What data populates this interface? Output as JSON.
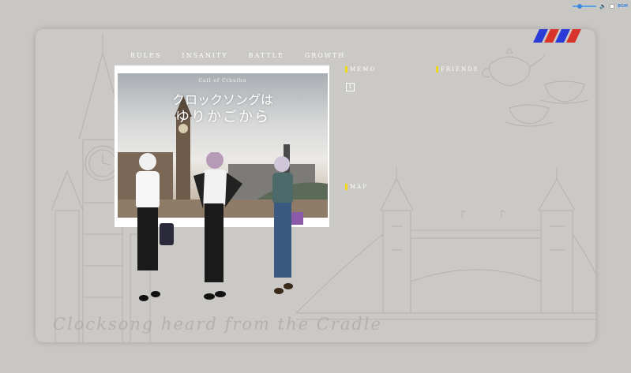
{
  "bgm": {
    "volume_icon": "speaker-icon",
    "label": "BGM"
  },
  "flag": {
    "colors": [
      "#2b3bd8",
      "#d8342b",
      "#2b3bd8",
      "#d8342b"
    ]
  },
  "nav": {
    "items": [
      {
        "label": "RULES"
      },
      {
        "label": "INSANITY"
      },
      {
        "label": "BATTLE"
      },
      {
        "label": "GROWTH"
      }
    ]
  },
  "hero": {
    "subtitle": "Call of Cthulhu",
    "title_line1": "クロックソングは",
    "title_line2": "ゆりかごから"
  },
  "sections": {
    "memo": {
      "label": "MEMO",
      "item": "1"
    },
    "friends": {
      "label": "FRIENDS"
    },
    "map": {
      "label": "MAP"
    }
  },
  "caption": "Clocksong heard from the Cradle",
  "colors": {
    "accent": "#f2d51b",
    "background": "#c9c7c4"
  }
}
